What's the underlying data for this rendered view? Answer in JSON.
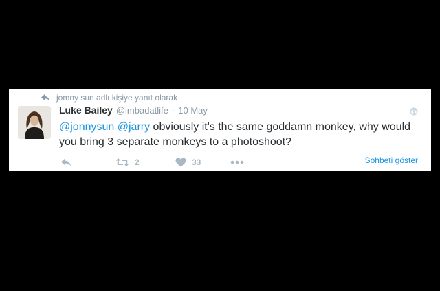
{
  "reply_context": {
    "icon": "reply-icon",
    "text": "jomny sun adlı kişiye yanıt olarak"
  },
  "tweet": {
    "author": {
      "fullname": "Luke Bailey",
      "username": "@imbadatlife"
    },
    "separator": "·",
    "timestamp": "10 May",
    "text": {
      "mention_1": "@jonnysun",
      "space": " ",
      "mention_2": "@jarry",
      "body": " obviously it's the same goddamn monkey, why would you bring 3 separate monkeys to a photoshoot?"
    },
    "actions": {
      "reply_icon": "reply-icon",
      "retweet_icon": "retweet-icon",
      "retweet_count": "2",
      "like_icon": "heart-icon",
      "like_count": "33",
      "more_icon": "more-dots-icon"
    },
    "show_conversation": "Sohbeti göster"
  },
  "colors": {
    "background": "#000000",
    "card": "#ffffff",
    "text": "#292f33",
    "muted": "#8899a6",
    "action_gray": "#aab8c2",
    "link_blue": "#1b95e0"
  }
}
